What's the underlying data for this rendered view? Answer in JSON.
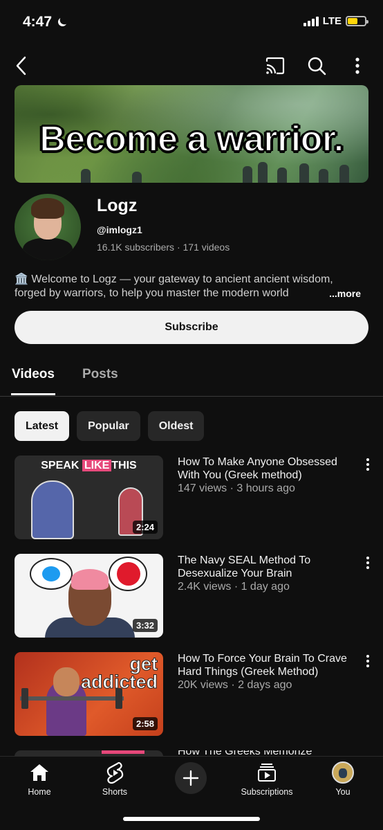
{
  "status_bar": {
    "time": "4:47",
    "network": "LTE",
    "battery_level": 0.6
  },
  "top_bar": {
    "back_icon": "back-arrow-icon",
    "cast_icon": "cast-icon",
    "search_icon": "search-icon",
    "more_icon": "more-vertical-icon"
  },
  "banner": {
    "text": "Become a warrior."
  },
  "channel": {
    "name": "Logz",
    "handle": "@imlogz1",
    "stats": "16.1K subscribers · 171 videos",
    "description_line1": "🏛️ Welcome to Logz — your gateway to ancient ancient wisdom,",
    "description_line2": "forged by warriors, to help you master the modern world",
    "more_label": "...more"
  },
  "subscribe_label": "Subscribe",
  "tabs": [
    {
      "label": "Videos",
      "active": true
    },
    {
      "label": "Posts",
      "active": false
    }
  ],
  "chips": [
    {
      "label": "Latest",
      "active": true
    },
    {
      "label": "Popular",
      "active": false
    },
    {
      "label": "Oldest",
      "active": false
    }
  ],
  "videos": [
    {
      "title": "How To Make Anyone Obsessed With You (Greek method)",
      "meta": "147 views · 3 hours ago",
      "duration": "2:24",
      "thumb_text_before": "SPEAK",
      "thumb_text_highlight": "LIKE",
      "thumb_text_after": "THIS"
    },
    {
      "title": "The Navy SEAL Method To Desexualize Your Brain",
      "meta": "2.4K views · 1 day ago",
      "duration": "3:32"
    },
    {
      "title": "How To Force Your Brain To Crave Hard Things (Greek Method)",
      "meta": "20K views · 2 days ago",
      "duration": "2:58",
      "thumb_text_line1": "get",
      "thumb_text_line2": "addicted"
    }
  ],
  "partial_video_title": "How The Greeks Memorize",
  "bottom_nav": [
    {
      "label": "Home",
      "icon": "home-icon"
    },
    {
      "label": "Shorts",
      "icon": "shorts-icon"
    },
    {
      "label": "",
      "icon": "create-plus-icon"
    },
    {
      "label": "Subscriptions",
      "icon": "subscriptions-icon"
    },
    {
      "label": "You",
      "icon": "profile-avatar-icon"
    }
  ],
  "colors": {
    "background": "#0f0f0f",
    "chip_active": "#f1f1f1",
    "chip_inactive": "#272727",
    "accent_pink": "#e6487a",
    "battery": "#ffd60a"
  }
}
